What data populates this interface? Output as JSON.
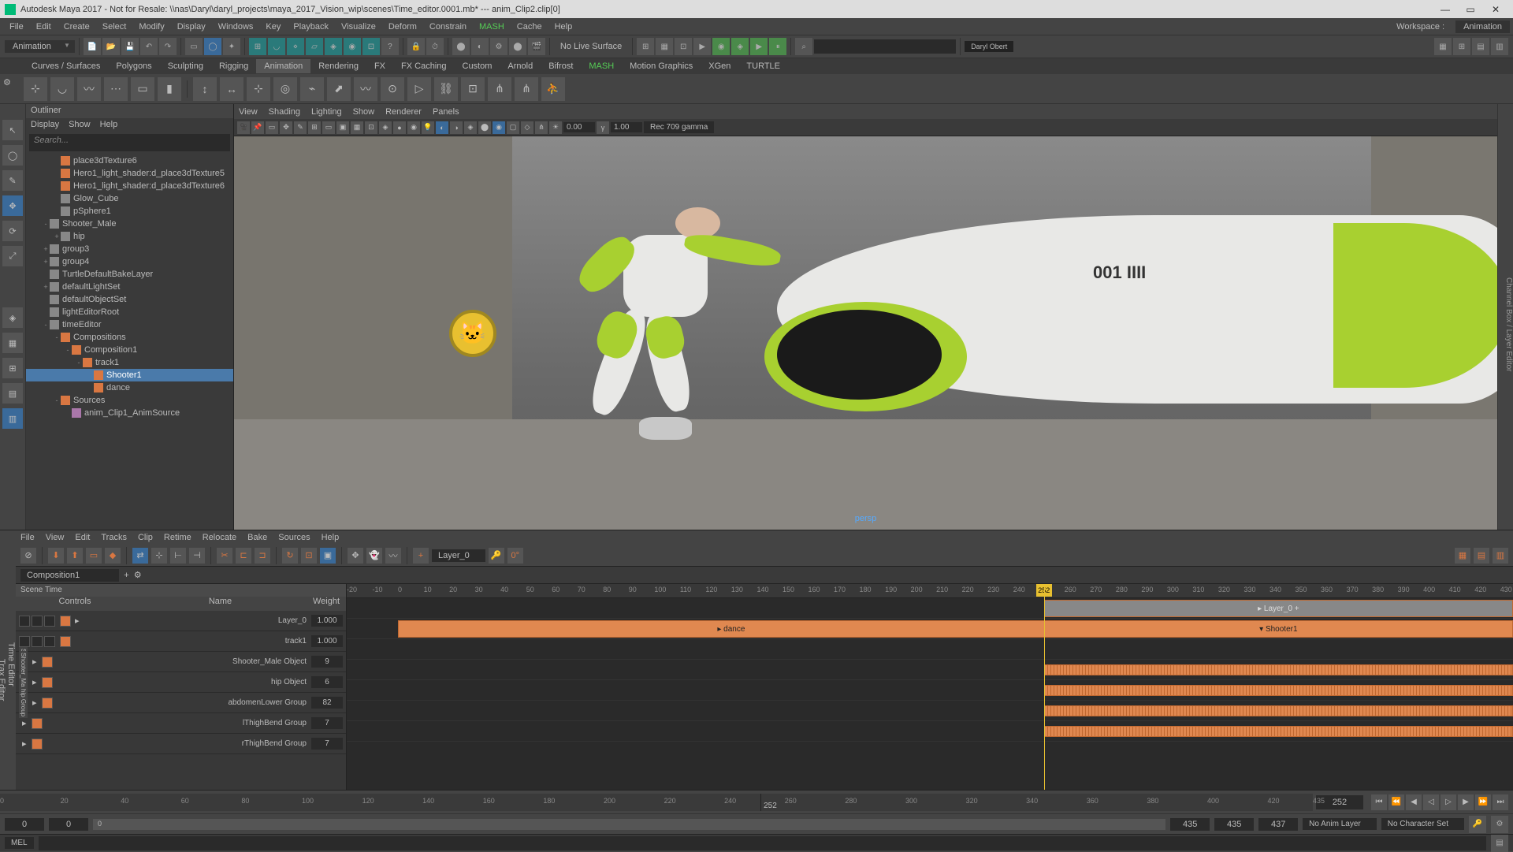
{
  "titlebar": {
    "text": "Autodesk Maya 2017 - Not for Resale: \\\\nas\\Daryl\\daryl_projects\\maya_2017_Vision_wip\\scenes\\Time_editor.0001.mb*  ---  anim_Clip2.clip[0]"
  },
  "menubar": {
    "items": [
      "File",
      "Edit",
      "Create",
      "Select",
      "Modify",
      "Display",
      "Windows",
      "Key",
      "Playback",
      "Visualize",
      "Deform",
      "Constrain",
      "MASH",
      "Cache",
      "Help"
    ],
    "workspace_label": "Workspace :",
    "workspace_value": "Animation"
  },
  "main_toolbar": {
    "mode_dropdown": "Animation",
    "live_label": "No Live Surface",
    "user_label": "Daryl Obert"
  },
  "shelf_tabs": [
    "Curves / Surfaces",
    "Polygons",
    "Sculpting",
    "Rigging",
    "Animation",
    "Rendering",
    "FX",
    "FX Caching",
    "Custom",
    "Arnold",
    "Bifrost",
    "MASH",
    "Motion Graphics",
    "XGen",
    "TURTLE"
  ],
  "shelf_active": "Animation",
  "outliner": {
    "title": "Outliner",
    "menu": [
      "Display",
      "Show",
      "Help"
    ],
    "search_placeholder": "Search...",
    "items": [
      {
        "indent": 1,
        "icon": "orange",
        "label": "place3dTexture6"
      },
      {
        "indent": 1,
        "icon": "orange",
        "label": "Hero1_light_shader:d_place3dTexture5"
      },
      {
        "indent": 1,
        "icon": "orange",
        "label": "Hero1_light_shader:d_place3dTexture6"
      },
      {
        "indent": 1,
        "icon": "gray",
        "label": "Glow_Cube"
      },
      {
        "indent": 1,
        "icon": "gray",
        "label": "pSphere1"
      },
      {
        "indent": 0,
        "expand": "-",
        "icon": "gray",
        "label": "Shooter_Male"
      },
      {
        "indent": 1,
        "expand": "+",
        "icon": "gray",
        "label": "hip"
      },
      {
        "indent": 0,
        "expand": "+",
        "icon": "gray",
        "label": "group3"
      },
      {
        "indent": 0,
        "expand": "+",
        "icon": "gray",
        "label": "group4"
      },
      {
        "indent": 0,
        "icon": "gray",
        "label": "TurtleDefaultBakeLayer"
      },
      {
        "indent": 0,
        "expand": "+",
        "icon": "gray",
        "label": "defaultLightSet"
      },
      {
        "indent": 0,
        "icon": "gray",
        "label": "defaultObjectSet"
      },
      {
        "indent": 0,
        "icon": "gray",
        "label": "lightEditorRoot"
      },
      {
        "indent": 0,
        "expand": "-",
        "icon": "gray",
        "label": "timeEditor"
      },
      {
        "indent": 1,
        "expand": "-",
        "icon": "orange",
        "label": "Compositions"
      },
      {
        "indent": 2,
        "expand": "-",
        "icon": "orange",
        "label": "Composition1"
      },
      {
        "indent": 3,
        "expand": "-",
        "icon": "orange",
        "label": "track1"
      },
      {
        "indent": 4,
        "icon": "orange",
        "label": "Shooter1",
        "selected": true
      },
      {
        "indent": 4,
        "icon": "orange",
        "label": "dance"
      },
      {
        "indent": 1,
        "expand": "-",
        "icon": "orange",
        "label": "Sources"
      },
      {
        "indent": 2,
        "icon": "purple",
        "label": "anim_Clip1_AnimSource"
      }
    ]
  },
  "viewport": {
    "menu": [
      "View",
      "Shading",
      "Lighting",
      "Show",
      "Renderer",
      "Panels"
    ],
    "exposure": "0.00",
    "gamma": "1.00",
    "color_profile": "Rec 709 gamma",
    "camera": "persp"
  },
  "time_editor": {
    "left_tab": "Time Editor",
    "trax_tab": "Trax Editor",
    "menu": [
      "File",
      "View",
      "Edit",
      "Tracks",
      "Clip",
      "Retime",
      "Relocate",
      "Bake",
      "Sources",
      "Help"
    ],
    "layer_dd": "Layer_0",
    "composition": "Composition1",
    "scene_time_label": "Scene Time",
    "headers": {
      "controls": "Controls",
      "name": "Name",
      "weight": "Weight"
    },
    "tracks": [
      {
        "name": "Layer_0",
        "weight": "1.000"
      },
      {
        "name": "track1",
        "weight": "1.000"
      },
      {
        "name": "Shooter_Male Object",
        "weight": "9",
        "group": "Shooter1"
      },
      {
        "name": "hip Object",
        "weight": "6",
        "group": "Shooter_Male Group"
      },
      {
        "name": "abdomenLower Group",
        "weight": "82",
        "group": "hip Group"
      },
      {
        "name": "lThighBend Group",
        "weight": "7"
      },
      {
        "name": "rThighBend Group",
        "weight": "7"
      }
    ],
    "ruler_start": -20,
    "ruler_end": 435,
    "current_frame": "252",
    "clips": {
      "layer0": {
        "label": "Layer_0",
        "start": 252,
        "end": 435
      },
      "dance": {
        "label": "dance",
        "start": 0,
        "end": 260
      },
      "shooter": {
        "label": "Shooter1",
        "start": 252,
        "end": 435
      }
    }
  },
  "range_slider": {
    "start": 0,
    "end": 435,
    "current": "252",
    "ticks": [
      0,
      20,
      40,
      60,
      80,
      100,
      120,
      140,
      160,
      180,
      200,
      220,
      240,
      260,
      280,
      300,
      320,
      340,
      360,
      380,
      400,
      420,
      435
    ]
  },
  "range_bar": {
    "in1": "0",
    "in2": "0",
    "handle_label": "0",
    "out1": "435",
    "out2": "435",
    "out3": "437",
    "anim_layer": "No Anim Layer",
    "char_set": "No Character Set"
  },
  "cmd": {
    "lang": "MEL"
  }
}
